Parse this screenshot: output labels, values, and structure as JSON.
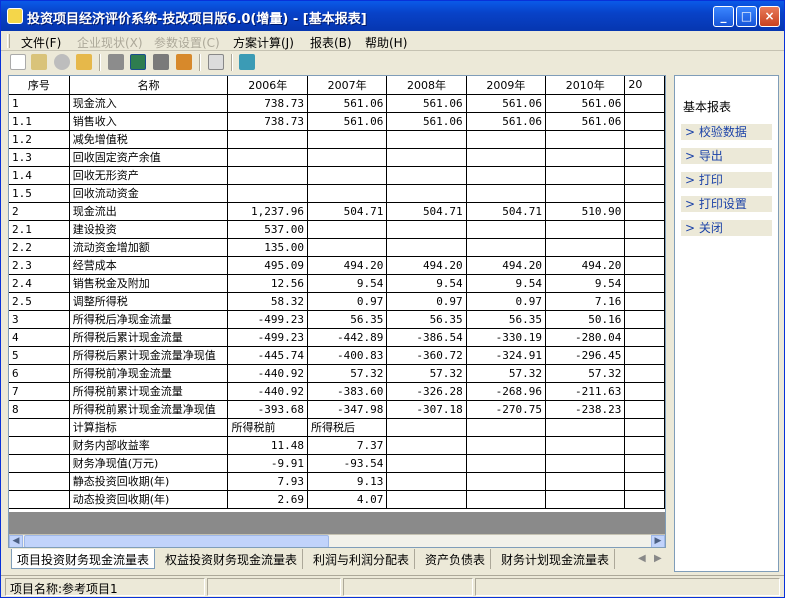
{
  "window": {
    "title": "投资项目经济评价系统-技改项目版6.0(增量) - [基本报表]",
    "min_glyph": "_",
    "max_glyph": "□",
    "close_glyph": "×"
  },
  "menu": {
    "items": [
      {
        "label": "文件(F)",
        "enabled": true
      },
      {
        "label": "企业现状(X)",
        "enabled": false
      },
      {
        "label": "参数设置(C)",
        "enabled": false
      },
      {
        "label": "方案计算(J)",
        "enabled": true
      },
      {
        "label": "报表(B)",
        "enabled": true
      },
      {
        "label": "帮助(H)",
        "enabled": true
      }
    ]
  },
  "toolbar": {
    "icons": [
      "new-file-icon",
      "open-folder-icon",
      "delete-icon",
      "export-folder-icon",
      "stop-icon",
      "excel-icon",
      "print-icon",
      "book-icon",
      "eraser-icon",
      "exit-door-icon"
    ]
  },
  "grid": {
    "headers": [
      "序号",
      "名称",
      "2006年",
      "2007年",
      "2008年",
      "2009年",
      "2010年",
      "20"
    ],
    "rows": [
      {
        "seq": "1",
        "name": "现金流入",
        "values": [
          "738.73",
          "561.06",
          "561.06",
          "561.06",
          "561.06"
        ]
      },
      {
        "seq": "1.1",
        "name": "销售收入",
        "values": [
          "738.73",
          "561.06",
          "561.06",
          "561.06",
          "561.06"
        ]
      },
      {
        "seq": "1.2",
        "name": "减免增值税",
        "values": [
          "",
          "",
          "",
          "",
          ""
        ]
      },
      {
        "seq": "1.3",
        "name": "回收固定资产余值",
        "values": [
          "",
          "",
          "",
          "",
          ""
        ]
      },
      {
        "seq": "1.4",
        "name": "回收无形资产",
        "values": [
          "",
          "",
          "",
          "",
          ""
        ]
      },
      {
        "seq": "1.5",
        "name": "回收流动资金",
        "values": [
          "",
          "",
          "",
          "",
          ""
        ]
      },
      {
        "seq": "2",
        "name": "现金流出",
        "values": [
          "1,237.96",
          "504.71",
          "504.71",
          "504.71",
          "510.90"
        ]
      },
      {
        "seq": "2.1",
        "name": "建设投资",
        "values": [
          "537.00",
          "",
          "",
          "",
          ""
        ]
      },
      {
        "seq": "2.2",
        "name": "流动资金增加额",
        "values": [
          "135.00",
          "",
          "",
          "",
          ""
        ]
      },
      {
        "seq": "2.3",
        "name": "经营成本",
        "values": [
          "495.09",
          "494.20",
          "494.20",
          "494.20",
          "494.20"
        ]
      },
      {
        "seq": "2.4",
        "name": "销售税金及附加",
        "values": [
          "12.56",
          "9.54",
          "9.54",
          "9.54",
          "9.54"
        ]
      },
      {
        "seq": "2.5",
        "name": "调整所得税",
        "values": [
          "58.32",
          "0.97",
          "0.97",
          "0.97",
          "7.16"
        ]
      },
      {
        "seq": "3",
        "name": "所得税后净现金流量",
        "values": [
          "-499.23",
          "56.35",
          "56.35",
          "56.35",
          "50.16"
        ]
      },
      {
        "seq": "4",
        "name": "所得税后累计现金流量",
        "values": [
          "-499.23",
          "-442.89",
          "-386.54",
          "-330.19",
          "-280.04"
        ]
      },
      {
        "seq": "5",
        "name": "所得税后累计现金流量净现值",
        "values": [
          "-445.74",
          "-400.83",
          "-360.72",
          "-324.91",
          "-296.45"
        ]
      },
      {
        "seq": "6",
        "name": "所得税前净现金流量",
        "values": [
          "-440.92",
          "57.32",
          "57.32",
          "57.32",
          "57.32"
        ]
      },
      {
        "seq": "7",
        "name": "所得税前累计现金流量",
        "values": [
          "-440.92",
          "-383.60",
          "-326.28",
          "-268.96",
          "-211.63"
        ]
      },
      {
        "seq": "8",
        "name": "所得税前累计现金流量净现值",
        "values": [
          "-393.68",
          "-347.98",
          "-307.18",
          "-270.75",
          "-238.23"
        ]
      }
    ],
    "indicators": {
      "header": {
        "name": "计算指标",
        "col1": "所得税前",
        "col2": "所得税后"
      },
      "rows": [
        {
          "name": "财务内部收益率",
          "col1": "11.48",
          "col2": "7.37"
        },
        {
          "name": "财务净现值(万元)",
          "col1": "-9.91",
          "col2": "-93.54"
        },
        {
          "name": "静态投资回收期(年)",
          "col1": "7.93",
          "col2": "9.13"
        },
        {
          "name": "动态投资回收期(年)",
          "col1": "2.69",
          "col2": "4.07"
        }
      ]
    }
  },
  "tabs": [
    {
      "label": "项目投资财务现金流量表",
      "active": true
    },
    {
      "label": "权益投资财务现金流量表",
      "active": false
    },
    {
      "label": "利润与利润分配表",
      "active": false
    },
    {
      "label": "资产负债表",
      "active": false
    },
    {
      "label": "财务计划现金流量表",
      "active": false
    }
  ],
  "side_panel": {
    "title": "基本报表",
    "links": [
      "> 校验数据",
      "> 导出",
      "> 打印",
      "> 打印设置",
      "> 关闭"
    ]
  },
  "status": {
    "project": "项目名称:参考项目1"
  },
  "colors": {
    "title_bar": "#0842c8",
    "link_text": "#1c43a8",
    "panel_bg": "#ece9d8"
  }
}
